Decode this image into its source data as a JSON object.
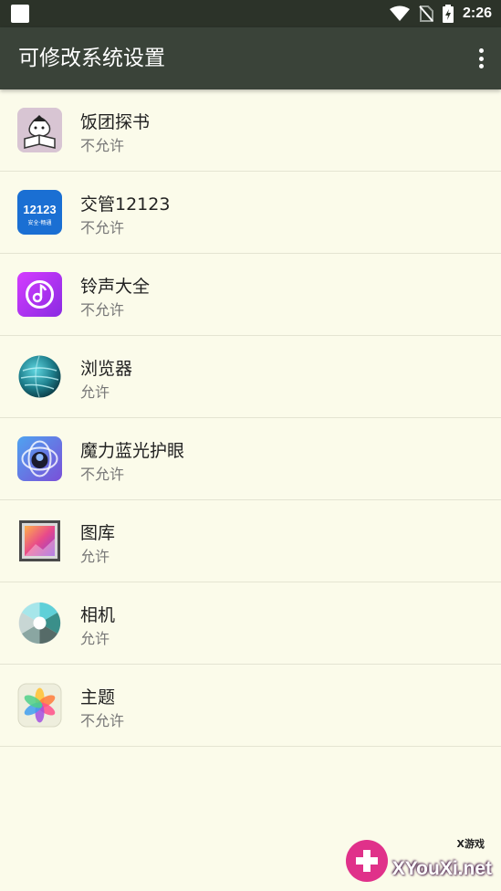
{
  "status": {
    "time": "2:26"
  },
  "appbar": {
    "title": "可修改系统设置"
  },
  "apps": [
    {
      "name": "饭团探书",
      "permission": "不允许",
      "icon": "fantuan-book-icon"
    },
    {
      "name": "交管12123",
      "permission": "不允许",
      "icon": "traffic-12123-icon"
    },
    {
      "name": "铃声大全",
      "permission": "不允许",
      "icon": "ringtone-music-icon"
    },
    {
      "name": "浏览器",
      "permission": "允许",
      "icon": "browser-globe-icon"
    },
    {
      "name": "魔力蓝光护眼",
      "permission": "不允许",
      "icon": "eye-care-icon"
    },
    {
      "name": "图库",
      "permission": "允许",
      "icon": "gallery-icon"
    },
    {
      "name": "相机",
      "permission": "允许",
      "icon": "camera-shutter-icon"
    },
    {
      "name": "主题",
      "permission": "不允许",
      "icon": "theme-flower-icon"
    }
  ],
  "icon_texts": {
    "traffic_number": "12123",
    "traffic_slogan": "安全·畅通"
  },
  "watermark": {
    "text": "XYouXi.net",
    "small": "X游戏"
  }
}
